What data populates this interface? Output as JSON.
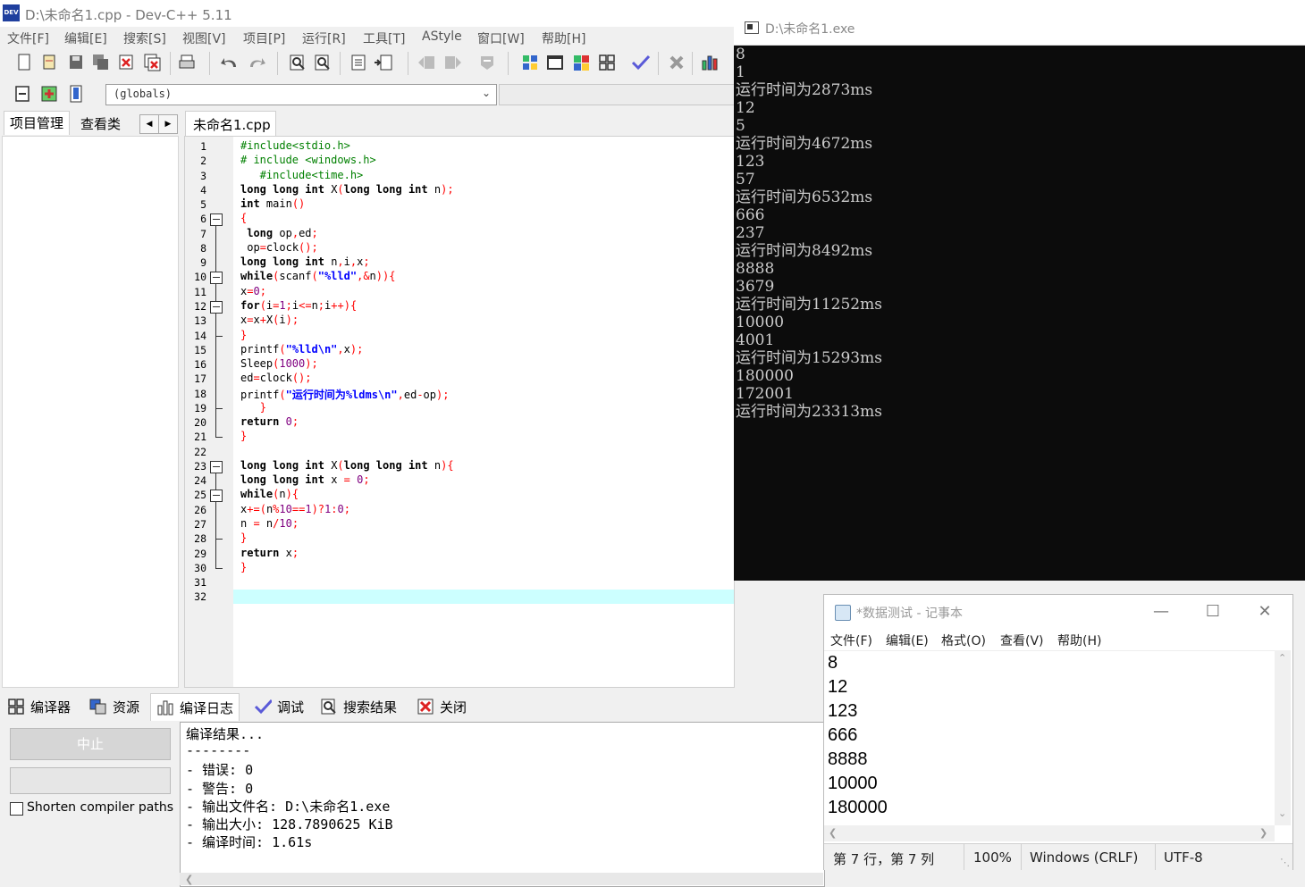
{
  "devcpp": {
    "title": "D:\\未命名1.cpp - Dev-C++ 5.11",
    "menu": [
      "文件[F]",
      "编辑[E]",
      "搜索[S]",
      "视图[V]",
      "项目[P]",
      "运行[R]",
      "工具[T]",
      "AStyle",
      "窗口[W]",
      "帮助[H]"
    ],
    "globals_combo": "(globals)",
    "left_tabs": [
      "项目管理",
      "查看类"
    ],
    "editor_tab": "未命名1.cpp",
    "line_numbers": [
      "1",
      "2",
      "3",
      "4",
      "5",
      "6",
      "7",
      "8",
      "9",
      "10",
      "11",
      "12",
      "13",
      "14",
      "15",
      "16",
      "17",
      "18",
      "19",
      "20",
      "21",
      "22",
      "23",
      "24",
      "25",
      "26",
      "27",
      "28",
      "29",
      "30",
      "31",
      "32"
    ],
    "code_lines": [
      "#include<stdio.h>",
      "# include <windows.h>",
      "   #include<time.h>",
      "long long int X(long long int n);",
      "int main()",
      "{",
      " long op,ed;",
      " op=clock();",
      "long long int n,i,x;",
      "while(scanf(\"%lld\",&n)){",
      "x=0;",
      "for(i=1;i<=n;i++){",
      "x=x+X(i);",
      "}",
      "printf(\"%lld\\n\",x);",
      "Sleep(1000);",
      "ed=clock();",
      "printf(\"运行时间为%ldms\\n\",ed-op);",
      "   }",
      "return 0;",
      "}",
      "",
      "long long int X(long long int n){",
      "long long int x = 0;",
      "while(n){",
      "x+=(n%10==1)?1:0;",
      "n = n/10;",
      "}",
      "return x;",
      "}",
      "",
      ""
    ],
    "bottom_tabs": [
      "编译器",
      "资源",
      "编译日志",
      "调试",
      "搜索结果",
      "关闭"
    ],
    "abort_button": "中止",
    "shorten_label": "Shorten compiler paths",
    "log_lines": [
      "编译结果...",
      "--------",
      "- 错误: 0",
      "- 警告: 0",
      "- 输出文件名: D:\\未命名1.exe",
      "- 输出大小: 128.7890625 KiB",
      "- 编译时间: 1.61s"
    ]
  },
  "console": {
    "title": "D:\\未命名1.exe",
    "lines": [
      "8",
      "1",
      "运行时间为2873ms",
      "12",
      "5",
      "运行时间为4672ms",
      "123",
      "57",
      "运行时间为6532ms",
      "666",
      "237",
      "运行时间为8492ms",
      "8888",
      "3679",
      "运行时间为11252ms",
      "10000",
      "4001",
      "运行时间为15293ms",
      "180000",
      "172001",
      "运行时间为23313ms"
    ]
  },
  "notepad": {
    "title": "*数据测试 - 记事本",
    "menu": [
      "文件(F)",
      "编辑(E)",
      "格式(O)",
      "查看(V)",
      "帮助(H)"
    ],
    "lines": [
      "8",
      "12",
      "123",
      "666",
      "8888",
      "10000",
      "180000"
    ],
    "status": {
      "position": "第 7 行，第 7 列",
      "zoom": "100%",
      "line_ending": "Windows (CRLF)",
      "encoding": "UTF-8"
    },
    "controls": {
      "minimize": "—",
      "maximize": "☐",
      "close": "✕"
    }
  }
}
